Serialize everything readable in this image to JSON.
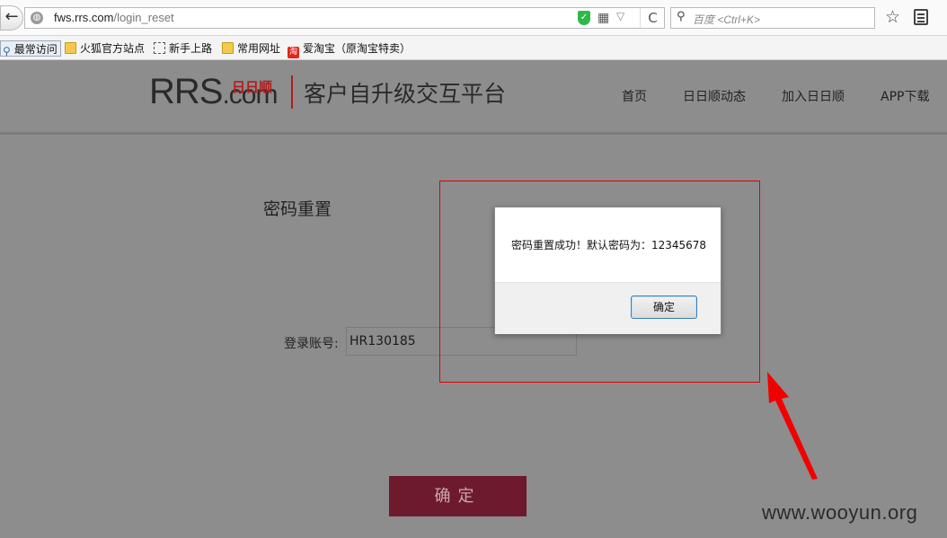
{
  "browser": {
    "url_host": "fws.rrs.com",
    "url_path": "/login_reset",
    "search_placeholder": "百度 <Ctrl+K>",
    "back_glyph": "←",
    "refresh_glyph": "C",
    "bookmarks": [
      {
        "label": "最常访问",
        "icon": "search-icon"
      },
      {
        "label": "火狐官方站点",
        "icon": "folder-icon"
      },
      {
        "label": "新手上路",
        "icon": "page-icon"
      },
      {
        "label": "常用网址",
        "icon": "folder-icon"
      },
      {
        "label": "爱淘宝（原淘宝特卖）",
        "icon": "taobao-icon"
      }
    ],
    "taobao_glyph": "淘"
  },
  "header": {
    "logo_main": "RRS",
    "logo_dom": ".com",
    "logo_cn": "日日顺",
    "platform": "客户自升级交互平台",
    "nav": [
      "首页",
      "日日顺动态",
      "加入日日顺",
      "APP下载"
    ]
  },
  "main": {
    "title": "密码重置",
    "account_label": "登录账号:",
    "account_value": "HR130185",
    "submit_label": "确定"
  },
  "dialog": {
    "message": "密码重置成功！默认密码为：12345678",
    "ok_label": "确定"
  },
  "watermark": "www.wooyun.org",
  "colors": {
    "overlay_bg": "#8d8d8d",
    "submit_bg": "#6e1a2e",
    "highlight": "#e10000",
    "brand_red": "#b31d1d"
  }
}
